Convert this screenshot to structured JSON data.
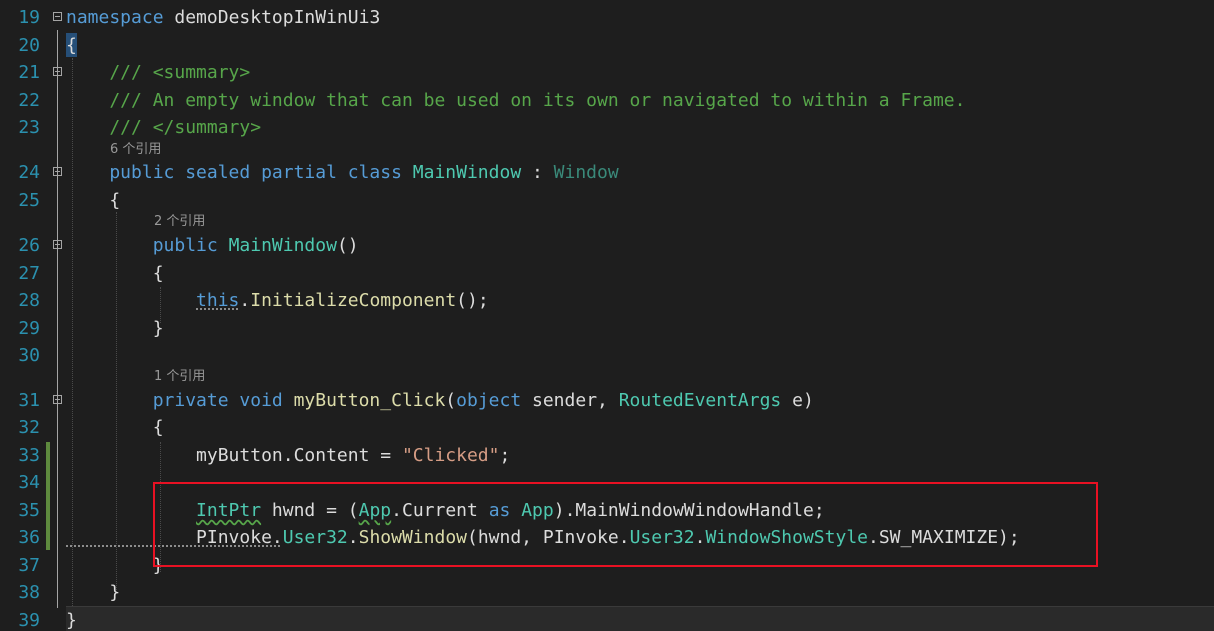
{
  "editor": {
    "lines": [
      {
        "num": "19",
        "code": [
          [
            "namespace",
            "kw"
          ],
          [
            " demoDesktopInWinUi3",
            "pl"
          ]
        ]
      },
      {
        "num": "20",
        "code": [
          [
            "{",
            "pl"
          ]
        ]
      },
      {
        "num": "21",
        "code": [
          [
            "    /// <summary>",
            "cm"
          ]
        ]
      },
      {
        "num": "22",
        "code": [
          [
            "    /// An empty window that can be used on its own or navigated to within a Frame.",
            "cm"
          ]
        ]
      },
      {
        "num": "23",
        "code": [
          [
            "    /// </summary>",
            "cm"
          ]
        ]
      },
      {
        "num": "24",
        "code": [
          [
            "    public sealed partial class ",
            "kw"
          ],
          [
            "MainWindow",
            "ty"
          ],
          [
            " : ",
            "pl"
          ],
          [
            "Window",
            "tyd"
          ]
        ]
      },
      {
        "num": "25",
        "code": [
          [
            "    {",
            "pl"
          ]
        ]
      },
      {
        "num": "26",
        "code": [
          [
            "        public ",
            "kw"
          ],
          [
            "MainWindow",
            "ty"
          ],
          [
            "()",
            "pl"
          ]
        ]
      },
      {
        "num": "27",
        "code": [
          [
            "        {",
            "pl"
          ]
        ]
      },
      {
        "num": "28",
        "code": [
          [
            "            ",
            "pl"
          ],
          [
            "this",
            "kw"
          ],
          [
            ".",
            "pl"
          ],
          [
            "InitializeComponent",
            "fn"
          ],
          [
            "();",
            "pl"
          ]
        ]
      },
      {
        "num": "29",
        "code": [
          [
            "        }",
            "pl"
          ]
        ]
      },
      {
        "num": "30",
        "code": []
      },
      {
        "num": "31",
        "code": [
          [
            "        private void ",
            "kw"
          ],
          [
            "myButton_Click",
            "fn"
          ],
          [
            "(",
            "pl"
          ],
          [
            "object",
            "kw"
          ],
          [
            " sender, ",
            "pl"
          ],
          [
            "RoutedEventArgs",
            "ty"
          ],
          [
            " e)",
            "pl"
          ]
        ]
      },
      {
        "num": "32",
        "code": [
          [
            "        {",
            "pl"
          ]
        ]
      },
      {
        "num": "33",
        "code": [
          [
            "            myButton.Content = ",
            "pl"
          ],
          [
            "\"Clicked\"",
            "st"
          ],
          [
            ";",
            "pl"
          ]
        ]
      },
      {
        "num": "34",
        "code": []
      },
      {
        "num": "35",
        "code": [
          [
            "            ",
            "pl"
          ],
          [
            "IntPtr",
            "ty"
          ],
          [
            " hwnd = (",
            "pl"
          ],
          [
            "App",
            "ty"
          ],
          [
            ".Current ",
            "pl"
          ],
          [
            "as",
            "kw"
          ],
          [
            " ",
            "pl"
          ],
          [
            "App",
            "ty"
          ],
          [
            ").MainWindowWindowHandle;",
            "pl"
          ]
        ]
      },
      {
        "num": "36",
        "code": [
          [
            "            PInvoke.",
            "pl"
          ],
          [
            "User32",
            "ty"
          ],
          [
            ".",
            "pl"
          ],
          [
            "ShowWindow",
            "fn"
          ],
          [
            "(hwnd, PInvoke.",
            "pl"
          ],
          [
            "User32",
            "ty"
          ],
          [
            ".",
            "pl"
          ],
          [
            "WindowShowStyle",
            "ty"
          ],
          [
            ".SW_MAXIMIZE);",
            "pl"
          ]
        ]
      },
      {
        "num": "37",
        "code": [
          [
            "        }",
            "pl"
          ]
        ]
      },
      {
        "num": "38",
        "code": [
          [
            "    }",
            "pl"
          ]
        ]
      },
      {
        "num": "39",
        "code": [
          [
            "}",
            "pl"
          ]
        ]
      }
    ],
    "codelens": {
      "class_refs": "6 个引用",
      "ctor_refs": "2 个引用",
      "method_refs": "1 个引用"
    },
    "colors": {
      "background": "#1e1e1e",
      "line_number": "#2b91af",
      "keyword": "#569cd6",
      "type": "#4ec9b0",
      "comment": "#57a64a",
      "string": "#d69d85",
      "method": "#dcdcaa",
      "highlight_box": "#e81123",
      "change_bar": "#5e8a3e"
    }
  }
}
